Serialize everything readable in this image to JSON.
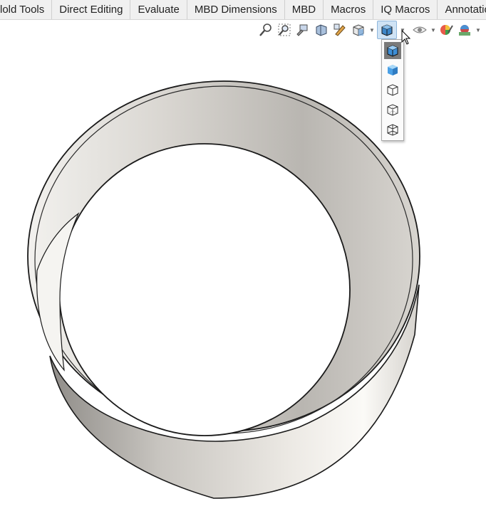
{
  "tabs": [
    {
      "label": "lold Tools"
    },
    {
      "label": "Direct Editing"
    },
    {
      "label": "Evaluate"
    },
    {
      "label": "MBD Dimensions"
    },
    {
      "label": "MBD"
    },
    {
      "label": "Macros"
    },
    {
      "label": "IQ Macros"
    },
    {
      "label": "Annotations"
    }
  ],
  "heads_up_toolbar": {
    "tools": [
      {
        "icon": "zoom-to-fit-icon"
      },
      {
        "icon": "zoom-to-area-icon"
      },
      {
        "icon": "previous-view-icon"
      },
      {
        "icon": "section-view-icon"
      },
      {
        "icon": "dynamic-annotation-views-icon"
      },
      {
        "icon": "view-orientation-icon"
      },
      {
        "icon": "display-style-icon",
        "active": true
      },
      {
        "icon": "hide-show-items-icon"
      },
      {
        "icon": "edit-appearance-icon"
      },
      {
        "icon": "apply-scene-icon"
      }
    ]
  },
  "display_style_flyout": {
    "options": [
      {
        "icon": "shaded-with-edges-icon",
        "selected": true
      },
      {
        "icon": "shaded-icon"
      },
      {
        "icon": "hidden-lines-removed-icon"
      },
      {
        "icon": "hidden-lines-visible-icon"
      },
      {
        "icon": "wireframe-icon"
      }
    ]
  },
  "model": {
    "shape": "ring-band",
    "color": "#e6e3de"
  }
}
